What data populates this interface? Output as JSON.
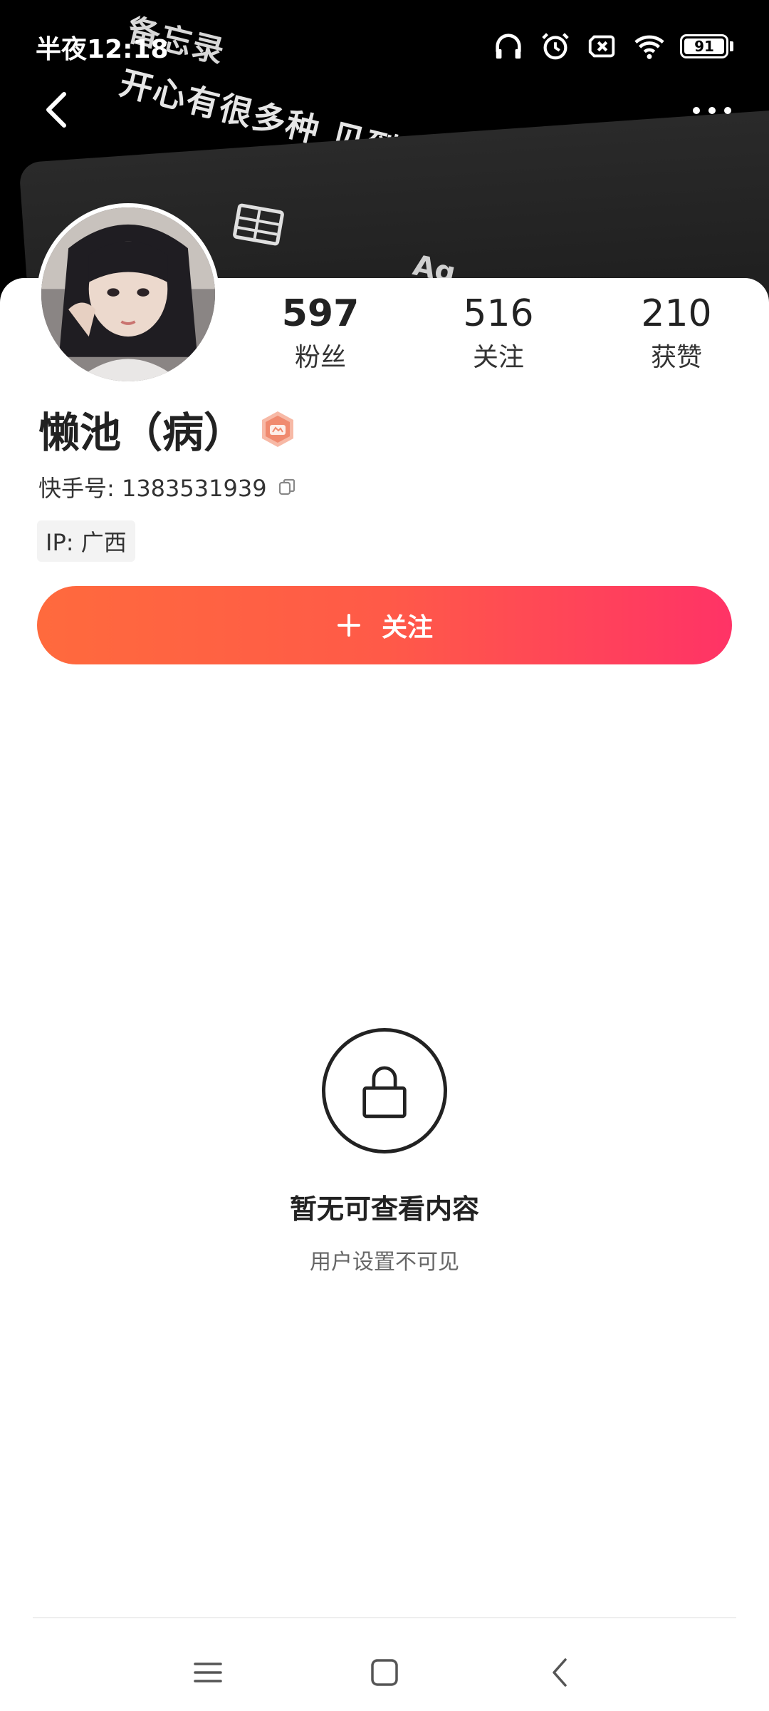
{
  "status_bar": {
    "time": "半夜12:18",
    "battery": "91",
    "icons": [
      "headphones-icon",
      "alarm-icon",
      "sim-off-icon",
      "wifi-icon",
      "battery-icon"
    ]
  },
  "banner": {
    "back_label": "备忘录",
    "text": "开心有很多种 见到你是第一种.",
    "fragment": "Ag"
  },
  "profile": {
    "name": "懒池（病）",
    "id_label": "快手号: 1383531939",
    "ip_label": "IP: 广西",
    "stats": [
      {
        "value": "597",
        "label": "粉丝"
      },
      {
        "value": "516",
        "label": "关注"
      },
      {
        "value": "210",
        "label": "获赞"
      }
    ]
  },
  "follow_button": {
    "label": "关注"
  },
  "empty_state": {
    "title": "暂无可查看内容",
    "subtitle": "用户设置不可见"
  },
  "colors": {
    "follow_gradient_start": "#ff6a3d",
    "follow_gradient_end": "#ff3366",
    "banner_bg": "#000000"
  }
}
